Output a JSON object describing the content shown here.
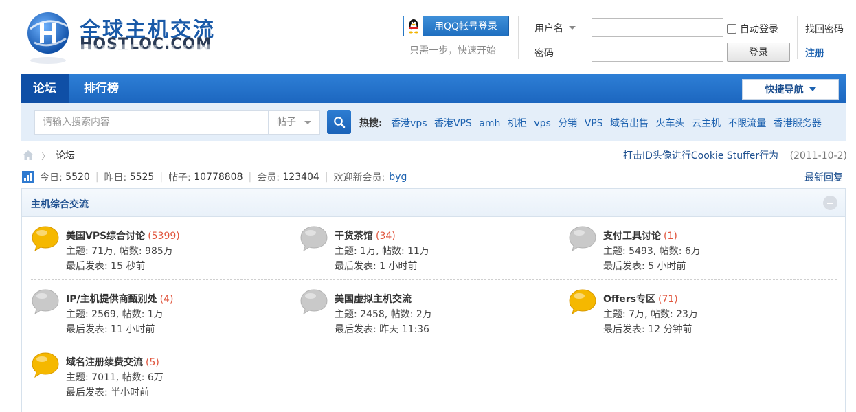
{
  "header": {
    "logo": {
      "cn": "全球主机交流",
      "en": "HOSTLOC.COM"
    },
    "qq_login_label": "用QQ帐号登录",
    "qq_hint": "只需一步，快速开始",
    "username_label": "用户名",
    "password_label": "密码",
    "auto_login_label": "自动登录",
    "login_button": "登录",
    "forgot_password": "找回密码",
    "register": "注册"
  },
  "nav": {
    "items": [
      {
        "label": "论坛",
        "active": true
      },
      {
        "label": "排行榜",
        "active": false
      }
    ],
    "quick_nav": "快捷导航"
  },
  "search": {
    "placeholder": "请输入搜索内容",
    "type": "帖子",
    "hot_label": "热搜:",
    "hot_items": [
      "香港vps",
      "香港VPS",
      "amh",
      "机柜",
      "vps",
      "分销",
      "VPS",
      "域名出售",
      "火车头",
      "云主机",
      "不限流量",
      "香港服务器"
    ]
  },
  "breadcrumb": {
    "current": "论坛"
  },
  "announcement": {
    "title": "打击ID头像进行Cookie Stuffer行为",
    "date": "(2011-10-2)"
  },
  "stats": {
    "today_label": "今日:",
    "today": "5520",
    "yesterday_label": "昨日:",
    "yesterday": "5525",
    "posts_label": "帖子:",
    "posts": "10778808",
    "members_label": "会员:",
    "members": "123404",
    "welcome_label": "欢迎新会员:",
    "newest_member": "byg",
    "latest_reply": "最新回复"
  },
  "category": {
    "title": "主机综合交流",
    "forums": [
      {
        "name": "美国VPS综合讨论",
        "today": "(5399)",
        "stats": "主题: 71万, 帖数: 985万",
        "last": "最后发表: 15 秒前",
        "active": true
      },
      {
        "name": "干货茶馆",
        "today": "(34)",
        "stats": "主题: 1万, 帖数: 11万",
        "last": "最后发表: 1 小时前",
        "active": false
      },
      {
        "name": "支付工具讨论",
        "today": "(1)",
        "stats": "主题: 5493, 帖数: 6万",
        "last": "最后发表: 5 小时前",
        "active": false
      },
      {
        "name": "IP/主机提供商甄别处",
        "today": "(4)",
        "stats": "主题: 2569, 帖数: 1万",
        "last": "最后发表: 11 小时前",
        "active": false
      },
      {
        "name": "美国虚拟主机交流",
        "today": "",
        "stats": "主题: 2458, 帖数: 2万",
        "last": "最后发表: 昨天 11:36",
        "active": false
      },
      {
        "name": "Offers专区",
        "today": "(71)",
        "stats": "主题: 7万, 帖数: 23万",
        "last": "最后发表: 12 分钟前",
        "active": true
      },
      {
        "name": "域名注册续费交流",
        "today": "(5)",
        "stats": "主题: 7011, 帖数: 6万",
        "last": "最后发表: 半小时前",
        "active": true
      }
    ]
  },
  "colors": {
    "nav_blue": "#1c66bf",
    "link_blue": "#1d62b0",
    "count_red": "#e0553d",
    "bubble_active": "#f5b800",
    "bubble_inactive": "#c9c9c9"
  }
}
